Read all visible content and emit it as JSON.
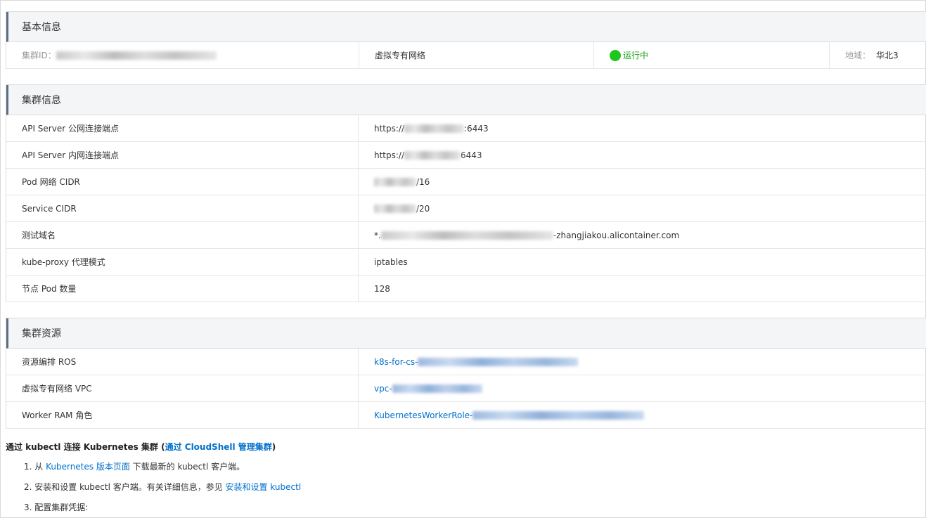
{
  "basic": {
    "header": "基本信息",
    "cluster_id_label": "集群ID：",
    "network_type": "虚拟专有网络",
    "status": "运行中",
    "region_label": "地域：",
    "region_value": "华北3"
  },
  "cluster_info": {
    "header": "集群信息",
    "rows": [
      {
        "label": "API Server 公网连接端点",
        "prefix": "https://",
        "suffix": ":6443"
      },
      {
        "label": "API Server 内网连接端点",
        "prefix": "https://",
        "suffix": "6443"
      },
      {
        "label": "Pod 网络 CIDR",
        "prefix": "",
        "suffix": "/16"
      },
      {
        "label": "Service CIDR",
        "prefix": "",
        "suffix": "/20"
      },
      {
        "label": "测试域名",
        "prefix": "*.",
        "suffix": "-zhangjiakou.alicontainer.com"
      },
      {
        "label": "kube-proxy 代理模式",
        "prefix": "iptables",
        "suffix": ""
      },
      {
        "label": "节点 Pod 数量",
        "prefix": "128",
        "suffix": ""
      }
    ]
  },
  "cluster_resources": {
    "header": "集群资源",
    "rows": [
      {
        "label": "资源编排 ROS",
        "link_prefix": "k8s-for-cs-"
      },
      {
        "label": "虚拟专有网络 VPC",
        "link_prefix": "vpc-"
      },
      {
        "label": "Worker RAM 角色",
        "link_prefix": "KubernetesWorkerRole-"
      }
    ]
  },
  "guide": {
    "title_prefix": "通过 kubectl 连接 Kubernetes 集群 (",
    "title_link": "通过 CloudShell 管理集群",
    "title_suffix": ")",
    "step1_prefix": "1. 从 ",
    "step1_link": "Kubernetes 版本页面",
    "step1_suffix": " 下载最新的 kubectl 客户端。",
    "step2_prefix": "2. 安装和设置 kubectl 客户端。有关详细信息，参见 ",
    "step2_link": "安装和设置 kubectl",
    "step3": "3. 配置集群凭据:"
  },
  "colors": {
    "link": "#0070cc",
    "status": "#1aa31a",
    "header_bg": "#f4f5f6",
    "header_accent": "#5a6e82"
  }
}
